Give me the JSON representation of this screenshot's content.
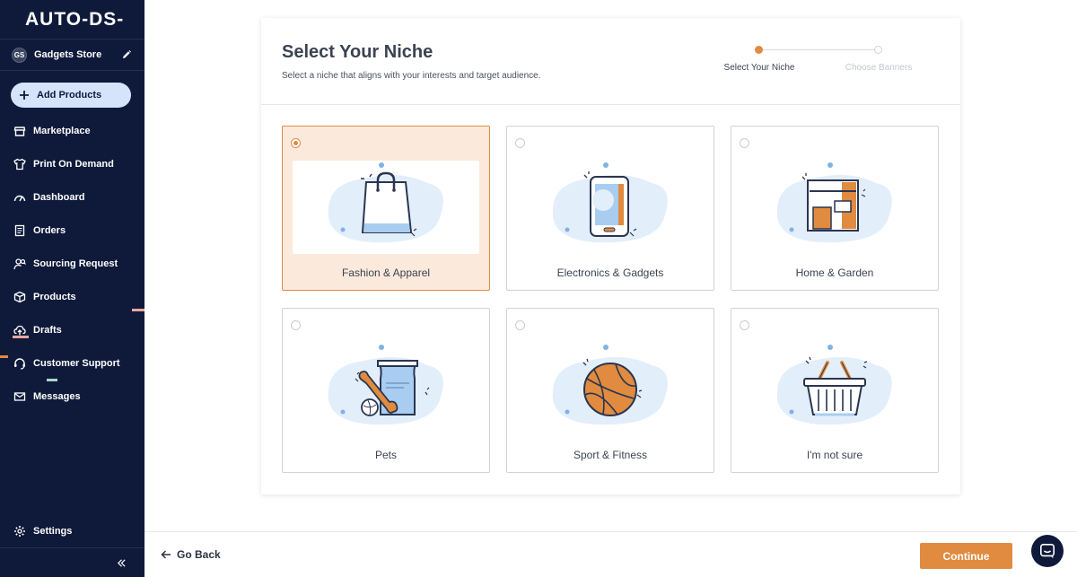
{
  "brand": {
    "logo_text": "AUTO-DS-"
  },
  "store": {
    "initials": "GS",
    "name": "Gadgets Store"
  },
  "sidebar": {
    "add_products": "Add Products",
    "items": [
      {
        "label": "Marketplace",
        "icon": "store-icon"
      },
      {
        "label": "Print On Demand",
        "icon": "shirt-icon"
      },
      {
        "label": "Dashboard",
        "icon": "gauge-icon"
      },
      {
        "label": "Orders",
        "icon": "receipt-icon"
      },
      {
        "label": "Sourcing Request",
        "icon": "user-search-icon"
      },
      {
        "label": "Products",
        "icon": "box-icon"
      },
      {
        "label": "Drafts",
        "icon": "cloud-upload-icon"
      },
      {
        "label": "Customer Support",
        "icon": "headset-icon"
      },
      {
        "label": "Messages",
        "icon": "mail-icon"
      }
    ],
    "settings": "Settings"
  },
  "header": {
    "title": "Select Your Niche",
    "subtitle": "Select a niche that aligns with your interests and target audience."
  },
  "stepper": {
    "steps": [
      {
        "label": "Select Your Niche",
        "active": true
      },
      {
        "label": "Choose Banners",
        "active": false
      }
    ]
  },
  "niches": [
    {
      "label": "Fashion & Apparel",
      "icon": "shopping-bag-icon",
      "selected": true
    },
    {
      "label": "Electronics & Gadgets",
      "icon": "smartphone-icon",
      "selected": false
    },
    {
      "label": "Home & Garden",
      "icon": "cabinet-icon",
      "selected": false
    },
    {
      "label": "Pets",
      "icon": "pet-food-icon",
      "selected": false
    },
    {
      "label": "Sport & Fitness",
      "icon": "basketball-icon",
      "selected": false
    },
    {
      "label": "I'm not sure",
      "icon": "basket-icon",
      "selected": false
    }
  ],
  "footer": {
    "go_back": "Go Back",
    "continue": "Continue"
  },
  "colors": {
    "sidebar_bg": "#0f1a3a",
    "accent": "#e08b40",
    "add_button_bg": "#d5e3fb",
    "selected_tile_bg": "#fbeadc"
  }
}
